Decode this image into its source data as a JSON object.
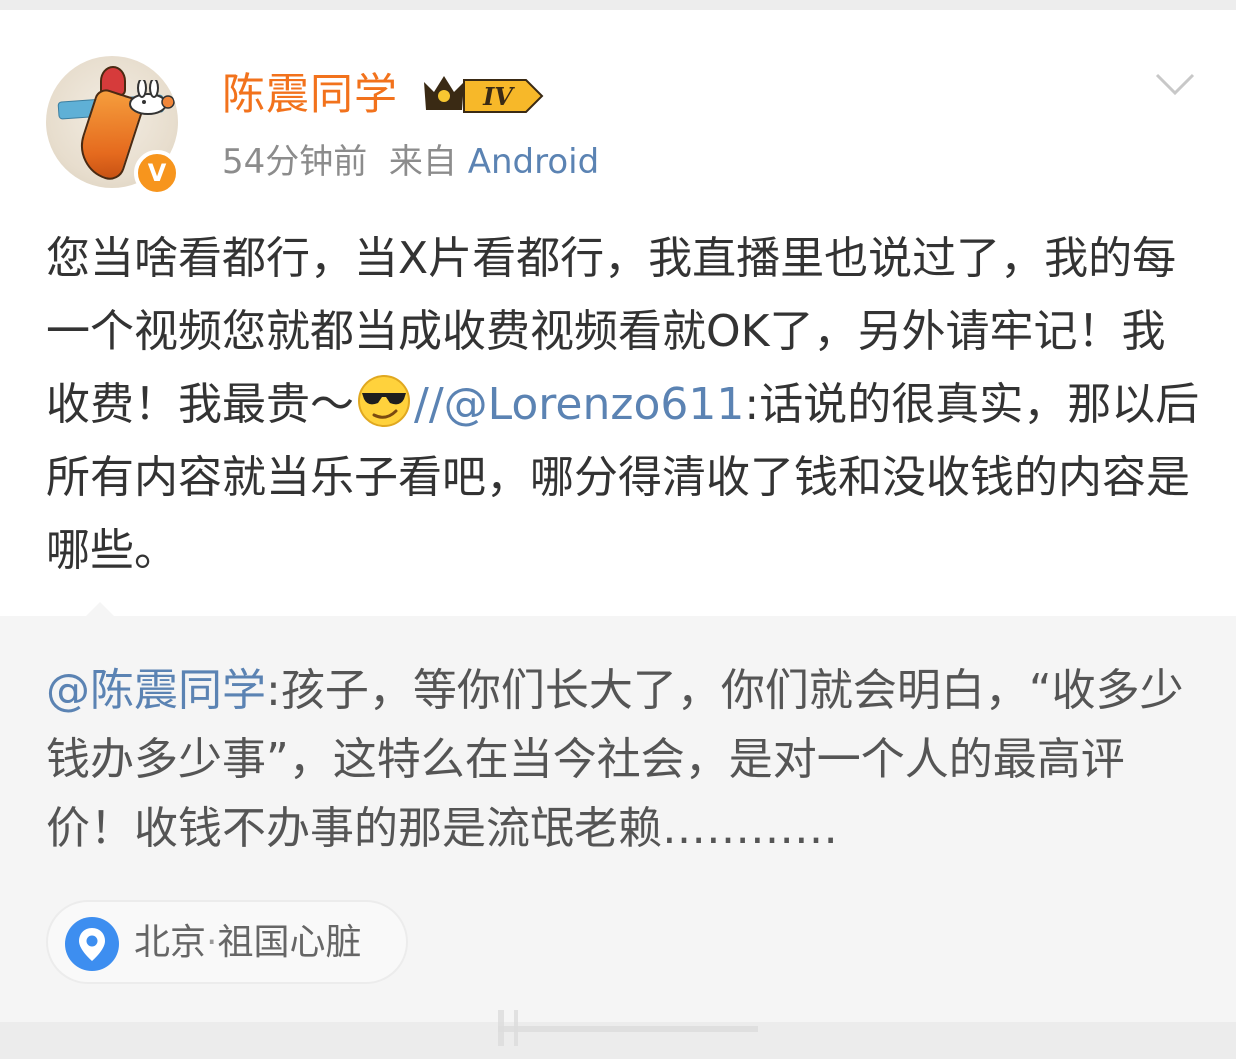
{
  "post": {
    "username": "陈震同学",
    "level_badge": "IV",
    "time": "54分钟前",
    "source_prefix": "来自",
    "source": "Android",
    "text_part1": "您当啥看都行，当X片看都行，我直播里也说过了，我的每一个视频您就都当成收费视频看就OK了，另外请牢记！我收费！我最贵～",
    "emoji": "sunglasses-emoji",
    "mention": "//@Lorenzo611",
    "text_part2": ":话说的很真实，那以后所有内容就当乐子看吧，哪分得清收了钱和没收钱的内容是哪些。"
  },
  "repost": {
    "mention": "@陈震同学",
    "text": ":孩子，等你们长大了，你们就会明白，“收多少钱办多少事”，这特么在当今社会，是对一个人的最高评价！收钱不办事的那是流氓老赖…………"
  },
  "location": {
    "city": "北京",
    "separator": "·",
    "place": "祖国心脏"
  },
  "colors": {
    "username": "#f2721c",
    "link": "#5b83b3",
    "verified": "#f7951d",
    "pin": "#3d8ef0"
  },
  "icons": [
    "verified-v-icon",
    "crown-level-icon",
    "chevron-down-icon",
    "sunglasses-emoji",
    "location-pin-icon"
  ]
}
